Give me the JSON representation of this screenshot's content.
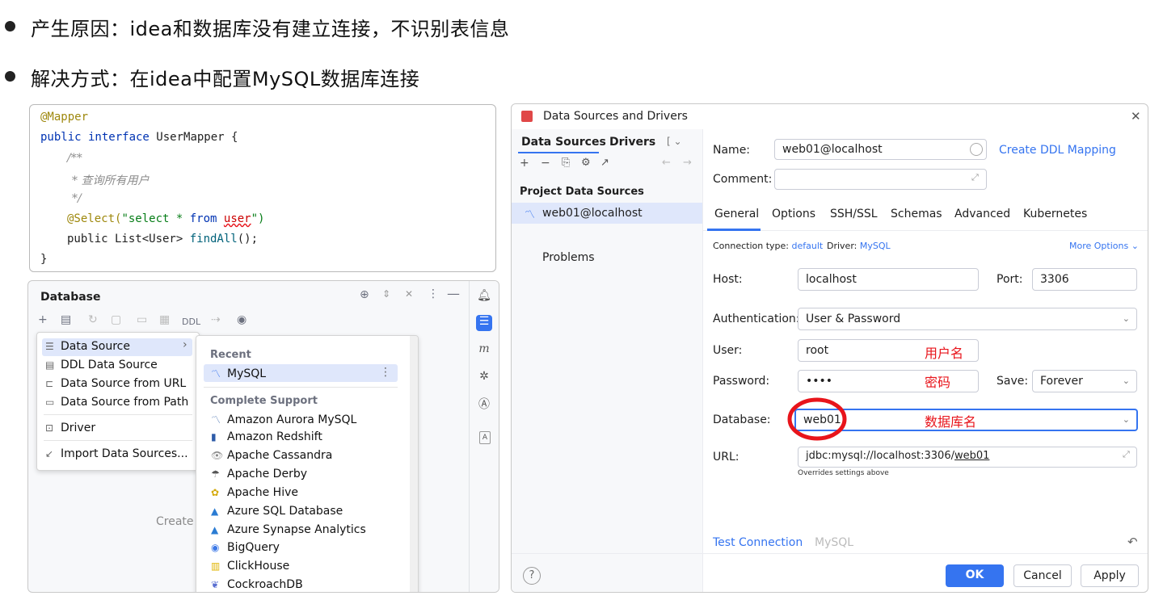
{
  "bullets": [
    "产生原因：idea和数据库没有建立连接，不识别表信息",
    "解决方式：在idea中配置MySQL数据库连接"
  ],
  "code": {
    "annotation1": "@Mapper",
    "line2_kw": "public interface",
    "line2_rest": "UserMapper {",
    "comment1": "/**",
    "comment2": "* 查询所有用户",
    "comment3": "*/",
    "select_ann": "@Select(",
    "select_str_a": "\"select * ",
    "select_str_from": "from",
    "select_str_user": "user",
    "select_str_end": "\")",
    "line6": "public List<User> ",
    "method": "findAll",
    "line6_end": "();",
    "close": "}"
  },
  "database_panel": {
    "title": "Database",
    "ddl_label": "DDL",
    "create_hint": "Create",
    "menu": [
      {
        "icon": "database-icon",
        "label": "Data Source",
        "arrow": "›"
      },
      {
        "icon": "ddl-icon",
        "label": "DDL Data Source"
      },
      {
        "icon": "url-icon",
        "label": "Data Source from URL"
      },
      {
        "icon": "folder-icon",
        "label": "Data Source from Path"
      },
      {
        "icon": "driver-icon",
        "label": "Driver"
      },
      {
        "icon": "import-icon",
        "label": "Import Data Sources..."
      }
    ],
    "submenu": {
      "recent_header": "Recent",
      "recent_item": "MySQL",
      "complete_header": "Complete Support",
      "items": [
        "Amazon Aurora MySQL",
        "Amazon Redshift",
        "Apache Cassandra",
        "Apache Derby",
        "Apache Hive",
        "Azure SQL Database",
        "Azure Synapse Analytics",
        "BigQuery",
        "ClickHouse",
        "CockroachDB"
      ]
    }
  },
  "dialog": {
    "title": "Data Sources and Drivers",
    "left_tabs": [
      "Data Sources",
      "Drivers"
    ],
    "project_header": "Project Data Sources",
    "selected_source": "web01@localhost",
    "problems": "Problems",
    "name_label": "Name:",
    "name_value": "web01@localhost",
    "create_ddl": "Create DDL Mapping",
    "comment_label": "Comment:",
    "tabs": [
      "General",
      "Options",
      "SSH/SSL",
      "Schemas",
      "Advanced",
      "Kubernetes"
    ],
    "conn_type_label": "Connection type:",
    "conn_type_value": "default",
    "driver_label": "Driver:",
    "driver_value": "MySQL",
    "more_options": "More Options",
    "host_label": "Host:",
    "host_value": "localhost",
    "port_label": "Port:",
    "port_value": "3306",
    "auth_label": "Authentication:",
    "auth_value": "User & Password",
    "user_label": "User:",
    "user_value": "root",
    "user_note": "用户名",
    "password_label": "Password:",
    "password_value": "••••",
    "password_note": "密码",
    "save_label": "Save:",
    "save_value": "Forever",
    "database_label": "Database:",
    "database_value": "web01",
    "database_note": "数据库名",
    "url_label": "URL:",
    "url_prefix": "jdbc:mysql://localhost:3306/",
    "url_db": "web01",
    "url_hint": "Overrides settings above",
    "test_connection": "Test Connection",
    "test_driver": "MySQL",
    "ok": "OK",
    "cancel": "Cancel",
    "apply": "Apply"
  },
  "colors": {
    "accent": "#3574f0",
    "annotation_red": "#e8141b"
  }
}
